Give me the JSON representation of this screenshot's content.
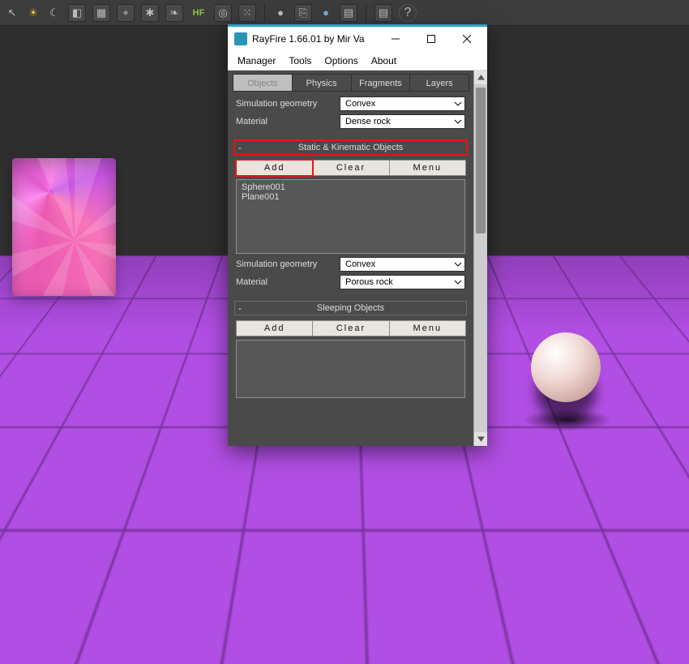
{
  "host_toolbar": {
    "icons": [
      {
        "name": "cursor-icon",
        "glyph": "↖"
      },
      {
        "name": "sun-icon",
        "glyph": "☀"
      },
      {
        "name": "moon-icon",
        "glyph": "☾"
      },
      {
        "name": "cube-icon",
        "glyph": "◧"
      },
      {
        "name": "grid-icon",
        "glyph": "▦"
      },
      {
        "name": "snap-icon",
        "glyph": "⌖"
      },
      {
        "name": "gear-icon",
        "glyph": "✱"
      },
      {
        "name": "leaf-icon",
        "glyph": "❧"
      },
      {
        "name": "hf-label",
        "glyph": "HF"
      },
      {
        "name": "target-icon",
        "glyph": "◎"
      },
      {
        "name": "noise-icon",
        "glyph": "⁙"
      },
      {
        "name": "sep",
        "glyph": ""
      },
      {
        "name": "shaded-sphere-icon",
        "glyph": "●"
      },
      {
        "name": "link-icon",
        "glyph": "⎘"
      },
      {
        "name": "blue-sphere-icon",
        "glyph": "●"
      },
      {
        "name": "window-icon",
        "glyph": "▤"
      },
      {
        "name": "sep",
        "glyph": ""
      },
      {
        "name": "script-icon",
        "glyph": "▤"
      },
      {
        "name": "help-icon",
        "glyph": "?"
      }
    ]
  },
  "dialog": {
    "title": "RayFire 1.66.01  by Mir Va",
    "menus": [
      "Manager",
      "Tools",
      "Options",
      "About"
    ],
    "tabs": [
      {
        "label": "Objects",
        "active": true
      },
      {
        "label": "Physics",
        "active": false
      },
      {
        "label": "Fragments",
        "active": false
      },
      {
        "label": "Layers",
        "active": false
      }
    ],
    "sim_top": {
      "sim_geom_label": "Simulation geometry",
      "sim_geom_value": "Convex",
      "material_label": "Material",
      "material_value": "Dense rock"
    },
    "static_kin": {
      "title": "Static & Kinematic Objects",
      "buttons": {
        "add": "Add",
        "clear": "Clear",
        "menu": "Menu"
      },
      "items": [
        "Sphere001",
        "Plane001"
      ],
      "sim_geom_label": "Simulation geometry",
      "sim_geom_value": "Convex",
      "material_label": "Material",
      "material_value": "Porous rock"
    },
    "sleeping": {
      "title": "Sleeping Objects",
      "buttons": {
        "add": "Add",
        "clear": "Clear",
        "menu": "Menu"
      },
      "items": []
    }
  },
  "scene": {
    "objects": [
      "fractured-box",
      "ground-plane",
      "sphere"
    ]
  }
}
